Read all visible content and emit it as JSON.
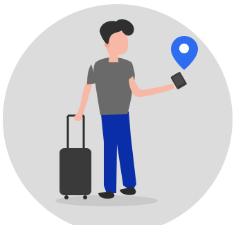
{
  "illustration": {
    "background_color": "#ffffff",
    "circle_color": "#dcdcdc",
    "shadow_color": "#c9c9c9",
    "skin_color": "#f7b8a6",
    "hair_color": "#2f2f2f",
    "shirt_color": "#6a6a6a",
    "pants_color": "#0a2ea8",
    "shoe_color": "#2b2b2b",
    "luggage_color": "#3a3a3a",
    "luggage_handle_color": "#2f2f2f",
    "phone_color": "#3a3a3a",
    "pin_color": "#2f6df0",
    "pin_center_color": "#ffffff",
    "icons": [
      "map-pin-icon",
      "smartphone-icon",
      "suitcase-icon"
    ]
  }
}
